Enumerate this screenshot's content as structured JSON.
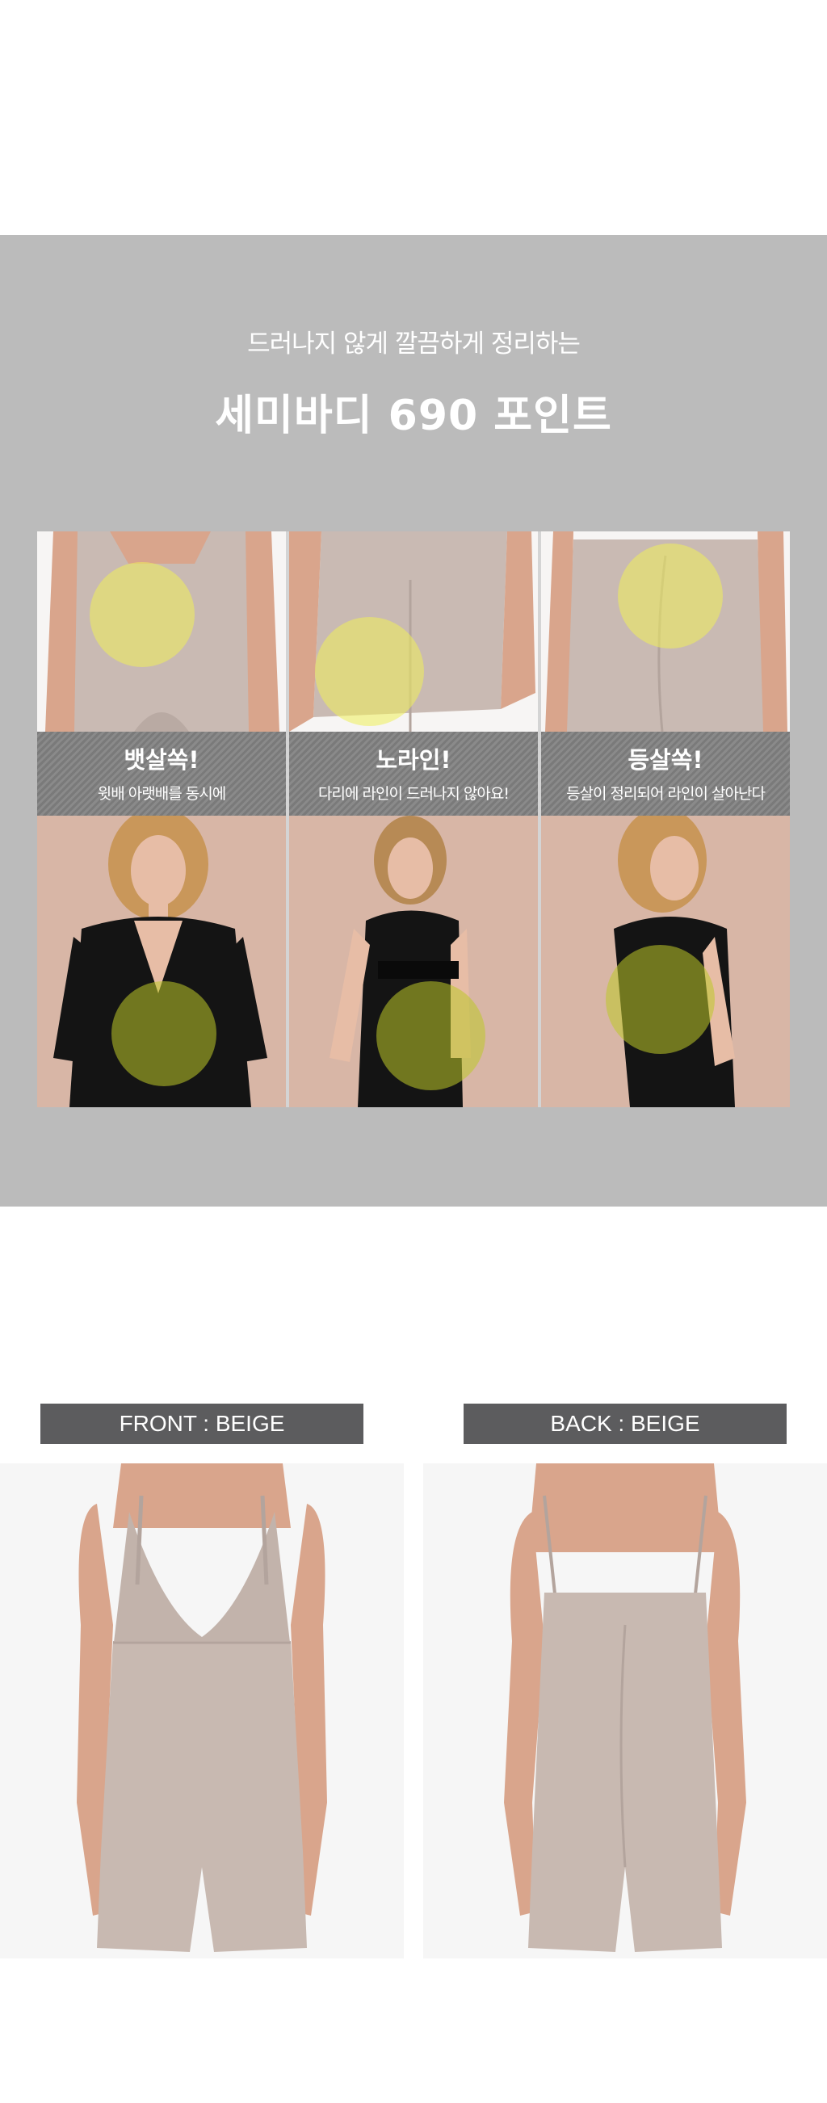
{
  "header": {
    "subtitle": "드러나지 않게 깔끔하게 정리하는",
    "title": "세미바디 690 포인트"
  },
  "points": [
    {
      "title": "뱃살쏙!",
      "desc": "윗배 아랫배를 동시에"
    },
    {
      "title": "노라인!",
      "desc": "다리에 라인이 드러나지 않아요!"
    },
    {
      "title": "등살쏙!",
      "desc": "등살이 정리되어 라인이 살아난다"
    }
  ],
  "views": {
    "front_label": "FRONT : BEIGE",
    "back_label": "BACK : BEIGE"
  },
  "colors": {
    "band": "#bbbbbb",
    "garment": "#c8b9b1",
    "skin": "#d9a58c",
    "highlight": "#eeee5a",
    "label_bg": "#5c5c5e"
  }
}
